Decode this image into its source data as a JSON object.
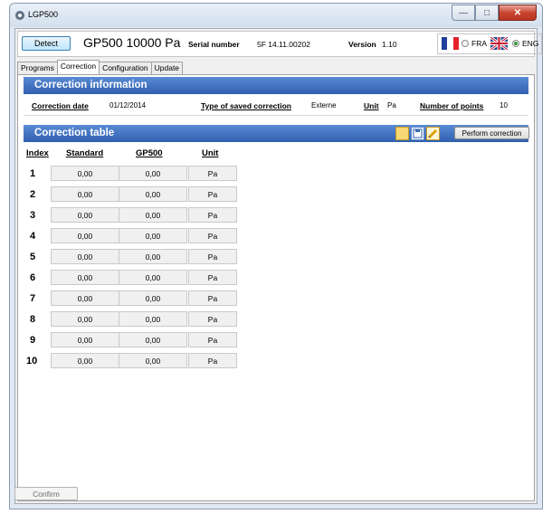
{
  "window": {
    "title": "LGP500"
  },
  "header": {
    "detect_label": "Detect",
    "device": "GP500 10000 Pa",
    "serial_label": "Serial number",
    "serial_value": "5F 14.11.00202",
    "version_label": "Version",
    "version_value": "1.10",
    "lang_fra": "FRA",
    "lang_eng": "ENG",
    "selected_lang": "ENG"
  },
  "tabs": [
    "Programs",
    "Correction",
    "Configuration",
    "Update"
  ],
  "active_tab": "Correction",
  "correction_info": {
    "title": "Correction information",
    "date_label": "Correction date",
    "date_value": "01/12/2014",
    "type_label": "Type of saved correction",
    "type_value": "Externe",
    "unit_label": "Unit",
    "unit_value": "Pa",
    "points_label": "Number of points",
    "points_value": "10"
  },
  "correction_table": {
    "title": "Correction table",
    "perform_label": "Perform correction",
    "toolbar_icons": [
      "folder-open-icon",
      "save-icon",
      "pencil-icon"
    ],
    "columns": [
      "Index",
      "Standard",
      "GP500",
      "Unit"
    ],
    "rows": [
      {
        "index": "1",
        "standard": "0,00",
        "gp500": "0,00",
        "unit": "Pa"
      },
      {
        "index": "2",
        "standard": "0,00",
        "gp500": "0,00",
        "unit": "Pa"
      },
      {
        "index": "3",
        "standard": "0,00",
        "gp500": "0,00",
        "unit": "Pa"
      },
      {
        "index": "4",
        "standard": "0,00",
        "gp500": "0,00",
        "unit": "Pa"
      },
      {
        "index": "5",
        "standard": "0,00",
        "gp500": "0,00",
        "unit": "Pa"
      },
      {
        "index": "6",
        "standard": "0,00",
        "gp500": "0,00",
        "unit": "Pa"
      },
      {
        "index": "7",
        "standard": "0,00",
        "gp500": "0,00",
        "unit": "Pa"
      },
      {
        "index": "8",
        "standard": "0,00",
        "gp500": "0,00",
        "unit": "Pa"
      },
      {
        "index": "9",
        "standard": "0,00",
        "gp500": "0,00",
        "unit": "Pa"
      },
      {
        "index": "10",
        "standard": "0,00",
        "gp500": "0,00",
        "unit": "Pa"
      }
    ]
  },
  "confirm_label": "Confirm"
}
